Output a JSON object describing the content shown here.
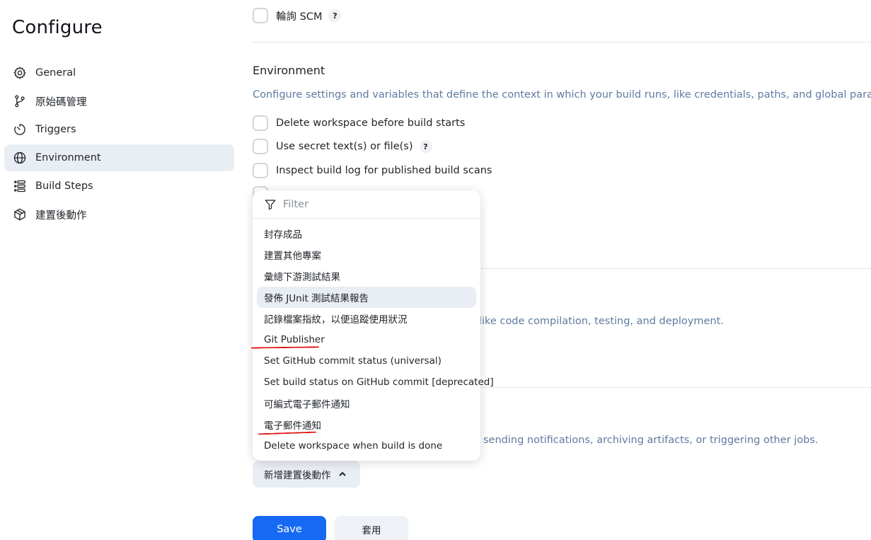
{
  "page": {
    "title": "Configure"
  },
  "sidebar": {
    "items": [
      {
        "label": "General",
        "icon": "gear-icon",
        "active": false
      },
      {
        "label": "原始碼管理",
        "icon": "git-branch-icon",
        "active": false
      },
      {
        "label": "Triggers",
        "icon": "timer-icon",
        "active": false
      },
      {
        "label": "Environment",
        "icon": "globe-icon",
        "active": true
      },
      {
        "label": "Build Steps",
        "icon": "list-steps-icon",
        "active": false
      },
      {
        "label": "建置後動作",
        "icon": "cube-icon",
        "active": false
      }
    ]
  },
  "triggers": {
    "poll_scm_label": "輪詢 SCM",
    "help_symbol": "?"
  },
  "environment": {
    "title": "Environment",
    "description": "Configure settings and variables that define the context in which your build runs, like credentials, paths, and global parameters.",
    "options": [
      {
        "label": "Delete workspace before build starts",
        "help": false
      },
      {
        "label": "Use secret text(s) or file(s)",
        "help": true
      },
      {
        "label": "Inspect build log for published build scans",
        "help": false
      }
    ]
  },
  "build_steps": {
    "description_fragment": "like code compilation, testing, and deployment."
  },
  "post_build": {
    "description_fragment": "sending notifications, archiving artifacts, or triggering other jobs.",
    "add_button_label": "新增建置後動作"
  },
  "dropdown": {
    "filter_placeholder": "Filter",
    "items": [
      "封存成品",
      "建置其他專案",
      "彙總下游測試結果",
      "發佈 JUnit 測試結果報告",
      "記錄檔案指紋，以便追蹤使用狀況",
      "Git Publisher",
      "Set GitHub commit status (universal)",
      "Set build status on GitHub commit [deprecated]",
      "可編式電子郵件通知",
      "電子郵件通知",
      "Delete workspace when build is done"
    ],
    "hovered_index": 3,
    "annotation_color": "#e01010"
  },
  "actions": {
    "save_label": "Save",
    "apply_label": "套用"
  },
  "colors": {
    "primary": "#1669f2",
    "description_text": "#5e7ba0",
    "active_nav_bg": "#e9edf4"
  }
}
